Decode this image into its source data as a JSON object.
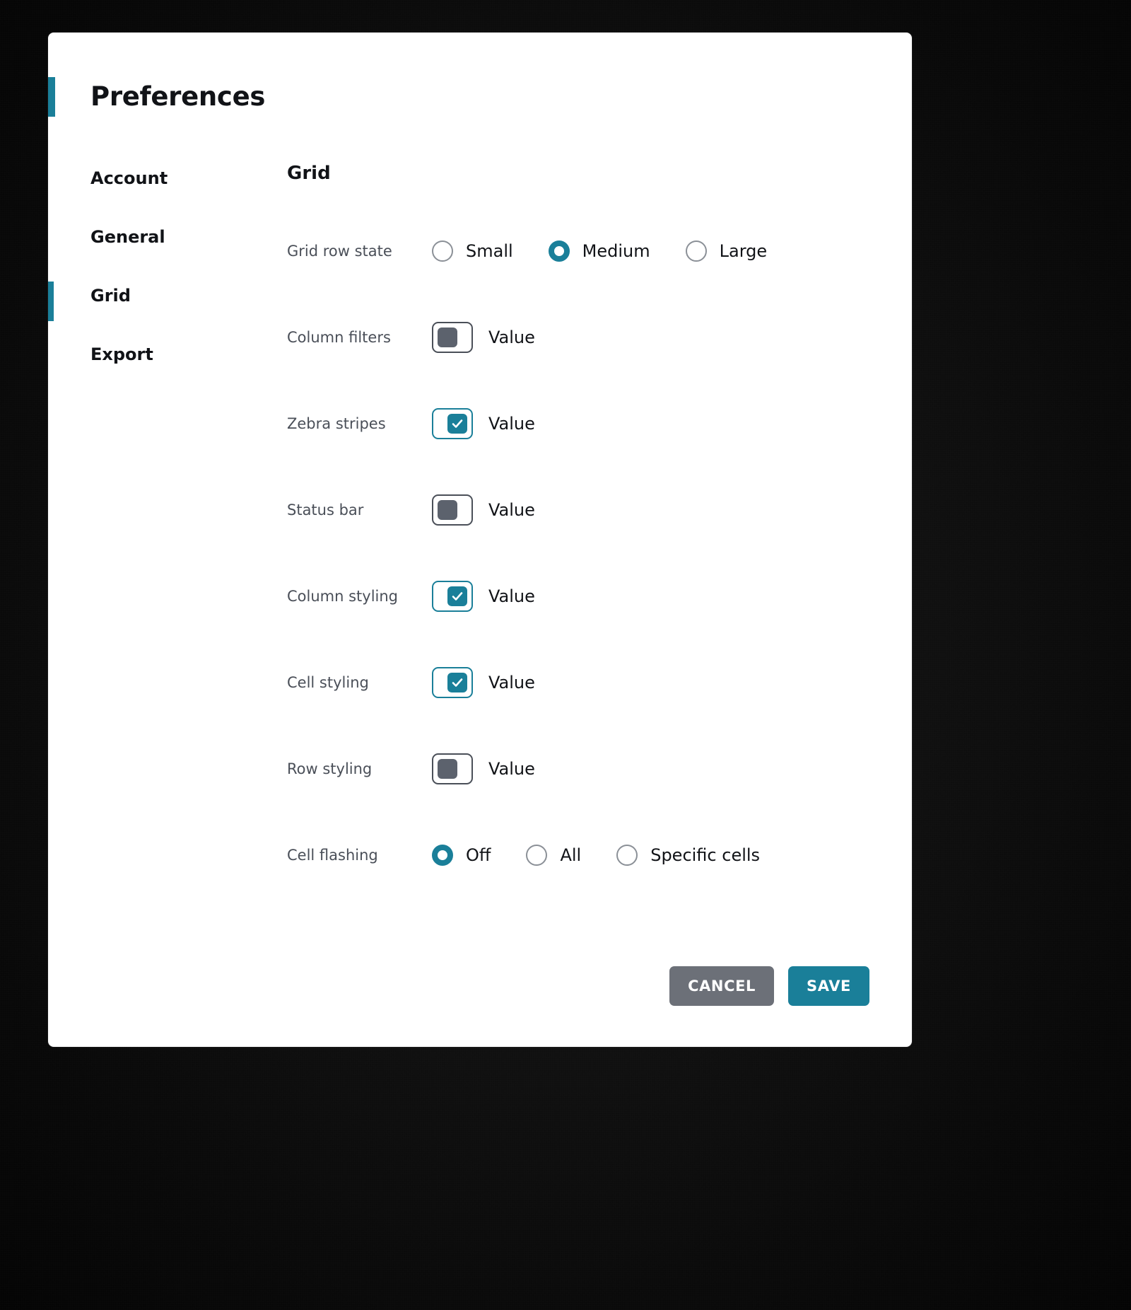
{
  "dialog": {
    "title": "Preferences",
    "accent_color": "#1a7f99"
  },
  "sidebar": {
    "items": [
      {
        "label": "Account",
        "active": false
      },
      {
        "label": "General",
        "active": false
      },
      {
        "label": "Grid",
        "active": true
      },
      {
        "label": "Export",
        "active": false
      }
    ]
  },
  "main": {
    "section_title": "Grid",
    "rows": [
      {
        "label": "Grid row state",
        "type": "radio",
        "options": [
          {
            "label": "Small",
            "selected": false
          },
          {
            "label": "Medium",
            "selected": true
          },
          {
            "label": "Large",
            "selected": false
          }
        ]
      },
      {
        "label": "Column filters",
        "type": "switch",
        "checked": false,
        "value_label": "Value"
      },
      {
        "label": "Zebra stripes",
        "type": "switch",
        "checked": true,
        "value_label": "Value"
      },
      {
        "label": "Status bar",
        "type": "switch",
        "checked": false,
        "value_label": "Value"
      },
      {
        "label": "Column styling",
        "type": "switch",
        "checked": true,
        "value_label": "Value"
      },
      {
        "label": "Cell styling",
        "type": "switch",
        "checked": true,
        "value_label": "Value"
      },
      {
        "label": "Row styling",
        "type": "switch",
        "checked": false,
        "value_label": "Value"
      },
      {
        "label": "Cell flashing",
        "type": "radio",
        "options": [
          {
            "label": "Off",
            "selected": true
          },
          {
            "label": "All",
            "selected": false
          },
          {
            "label": "Specific cells",
            "selected": false
          }
        ]
      }
    ]
  },
  "footer": {
    "cancel_label": "CANCEL",
    "save_label": "SAVE",
    "cancel_color": "#6c7078",
    "save_color": "#1a7f99"
  }
}
